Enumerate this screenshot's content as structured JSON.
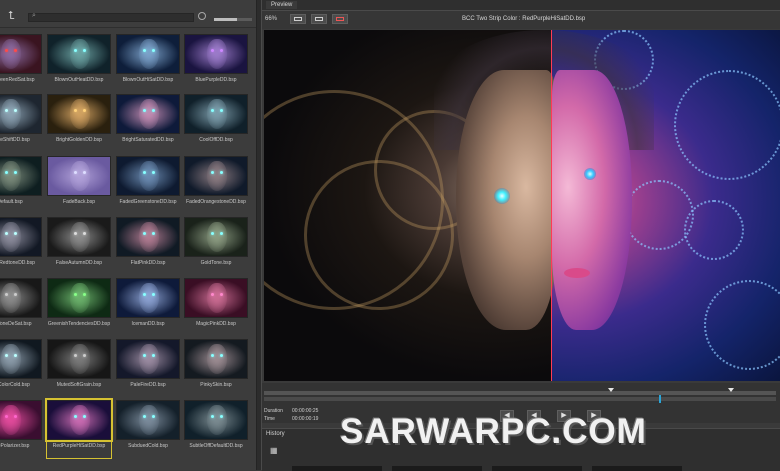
{
  "browser": {
    "search_placeholder": "",
    "slider_value": 0.6,
    "presets": [
      {
        "label": "RedGreenRedSat.bsp",
        "bg": "#3a1420",
        "face": "#8a6aa0",
        "eye": "#ff4a4a"
      },
      {
        "label": "BlownOutHeatDD.bsp",
        "bg": "#10222a",
        "face": "#6aa0a0",
        "eye": "#8ff"
      },
      {
        "label": "BlownOutHiSatDD.bsp",
        "bg": "#0e1e3a",
        "face": "#7aa0c8",
        "eye": "#8ff"
      },
      {
        "label": "BluePurpleDD.bsp",
        "bg": "#1a1440",
        "face": "#9a7ac8",
        "eye": "#c8f"
      },
      {
        "label": "WhiteShiftDD.bsp",
        "bg": "#1e2630",
        "face": "#8aa0b0",
        "eye": "#bff"
      },
      {
        "label": "BrightGoldenDD.bsp",
        "bg": "#2a200e",
        "face": "#d0a060",
        "eye": "#ffd27a"
      },
      {
        "label": "BrightSaturatedDD.bsp",
        "bg": "#0e1a3a",
        "face": "#c08ab0",
        "eye": "#8ff"
      },
      {
        "label": "CoolOffDD.bsp",
        "bg": "#10202a",
        "face": "#7a9aa8",
        "eye": "#8ff"
      },
      {
        "label": "Default.bsp",
        "bg": "#0e1e20",
        "face": "#7a8a7a",
        "eye": "#8ff"
      },
      {
        "label": "FadeBack.bsp",
        "bg": "#6a5aa0",
        "face": "#b0a0d8",
        "eye": "#ddf"
      },
      {
        "label": "FadedGreenstoneDD.bsp",
        "bg": "#0e1a30",
        "face": "#6a8ab0",
        "eye": "#8ff"
      },
      {
        "label": "FadedOrangestoneDD.bsp",
        "bg": "#101a2a",
        "face": "#8a7a80",
        "eye": "#8ff"
      },
      {
        "label": "FadedRedtoneDD.bsp",
        "bg": "#121824",
        "face": "#8a8a9a",
        "eye": "#bff"
      },
      {
        "label": "FalseAutumnDD.bsp",
        "bg": "#1a1a1a",
        "face": "#8a8a8a",
        "eye": "#ddd"
      },
      {
        "label": "FlatPinkDD.bsp",
        "bg": "#101a24",
        "face": "#b07a90",
        "eye": "#8ff"
      },
      {
        "label": "GoldTone.bsp",
        "bg": "#1a221a",
        "face": "#8a9a80",
        "eye": "#8ff"
      },
      {
        "label": "HalfToneDeSat.bsp",
        "bg": "#181818",
        "face": "#8a8a8a",
        "eye": "#ccc"
      },
      {
        "label": "GreenishTendenciesDD.bsp",
        "bg": "#0e2a14",
        "face": "#6ab06a",
        "eye": "#8f8"
      },
      {
        "label": "IcemanDD.bsp",
        "bg": "#0e1a3a",
        "face": "#8aa0d0",
        "eye": "#8ff"
      },
      {
        "label": "MagicPinkDD.bsp",
        "bg": "#3a0e24",
        "face": "#c86a90",
        "eye": "#f8c"
      },
      {
        "label": "HotColorCold.bsp",
        "bg": "#101820",
        "face": "#8a9aa8",
        "eye": "#bff"
      },
      {
        "label": "MutedSoftGrain.bsp",
        "bg": "#161616",
        "face": "#7a7a7a",
        "eye": "#ccc"
      },
      {
        "label": "PaleFireDD.bsp",
        "bg": "#14182a",
        "face": "#9a8aa0",
        "eye": "#8ff"
      },
      {
        "label": "PinkySkin.bsp",
        "bg": "#141a20",
        "face": "#9a8a90",
        "eye": "#8ff"
      },
      {
        "label": "BluePolarizer.bsp",
        "bg": "#3a0e30",
        "face": "#e04a9a",
        "eye": "#f6c"
      },
      {
        "label": "RedPurpleHiSatDD.bsp",
        "bg": "#1a0e3a",
        "face": "#c86ab0",
        "eye": "#8ff"
      },
      {
        "label": "SubduedCold.bsp",
        "bg": "#14202a",
        "face": "#7a8a9a",
        "eye": "#8ff"
      },
      {
        "label": "SubtleOffDefaultDD.bsp",
        "bg": "#10202a",
        "face": "#7a8a90",
        "eye": "#8ff"
      }
    ]
  },
  "preview": {
    "tab_label": "Preview",
    "zoom": "66%",
    "title": "BCC Two Strip Color : RedPurpleHiSatDD.bsp"
  },
  "timeline": {
    "duration_label": "Duration",
    "duration_value": "00:00:00:25",
    "time_label": "Time",
    "time_value": "00:00:00:19"
  },
  "history": {
    "tab_label": "History"
  },
  "watermark": "SARWARPC.COM",
  "colors": {
    "split_line": "#ff3b55",
    "selection": "#d6c232",
    "playhead": "#2aa5d8"
  }
}
